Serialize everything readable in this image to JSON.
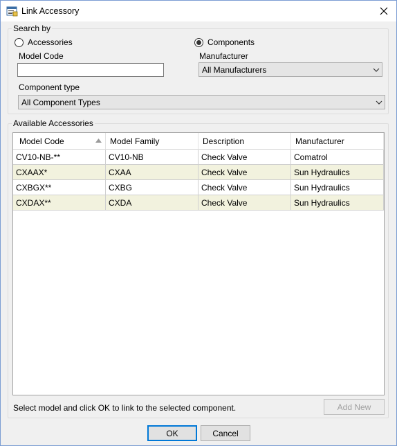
{
  "window": {
    "title": "Link Accessory",
    "icon": "dialog-icon",
    "close_icon": "close-icon"
  },
  "search": {
    "group_label": "Search by",
    "radio_accessories": "Accessories",
    "radio_components": "Components",
    "selected": "Components",
    "model_code_label": "Model Code",
    "model_code_value": "",
    "manufacturer_label": "Manufacturer",
    "manufacturer_value": "All Manufacturers",
    "component_type_label": "Component type",
    "component_type_value": "All Component Types"
  },
  "available": {
    "group_label": "Available Accessories",
    "columns": [
      "Model Code",
      "Model Family",
      "Description",
      "Manufacturer"
    ],
    "sorted_column": "Model Code",
    "rows": [
      [
        "CV10-NB-**",
        "CV10-NB",
        "Check Valve",
        "Comatrol"
      ],
      [
        "CXAAX*",
        "CXAA",
        "Check Valve",
        "Sun Hydraulics"
      ],
      [
        "CXBGX**",
        "CXBG",
        "Check Valve",
        "Sun Hydraulics"
      ],
      [
        "CXDAX**",
        "CXDA",
        "Check Valve",
        "Sun Hydraulics"
      ]
    ]
  },
  "footer": {
    "hint": "Select model and click OK to link to the selected component.",
    "add_new": "Add New",
    "ok": "OK",
    "cancel": "Cancel"
  },
  "colors": {
    "alt_row": "#f2f2de",
    "accent": "#0078d7"
  }
}
